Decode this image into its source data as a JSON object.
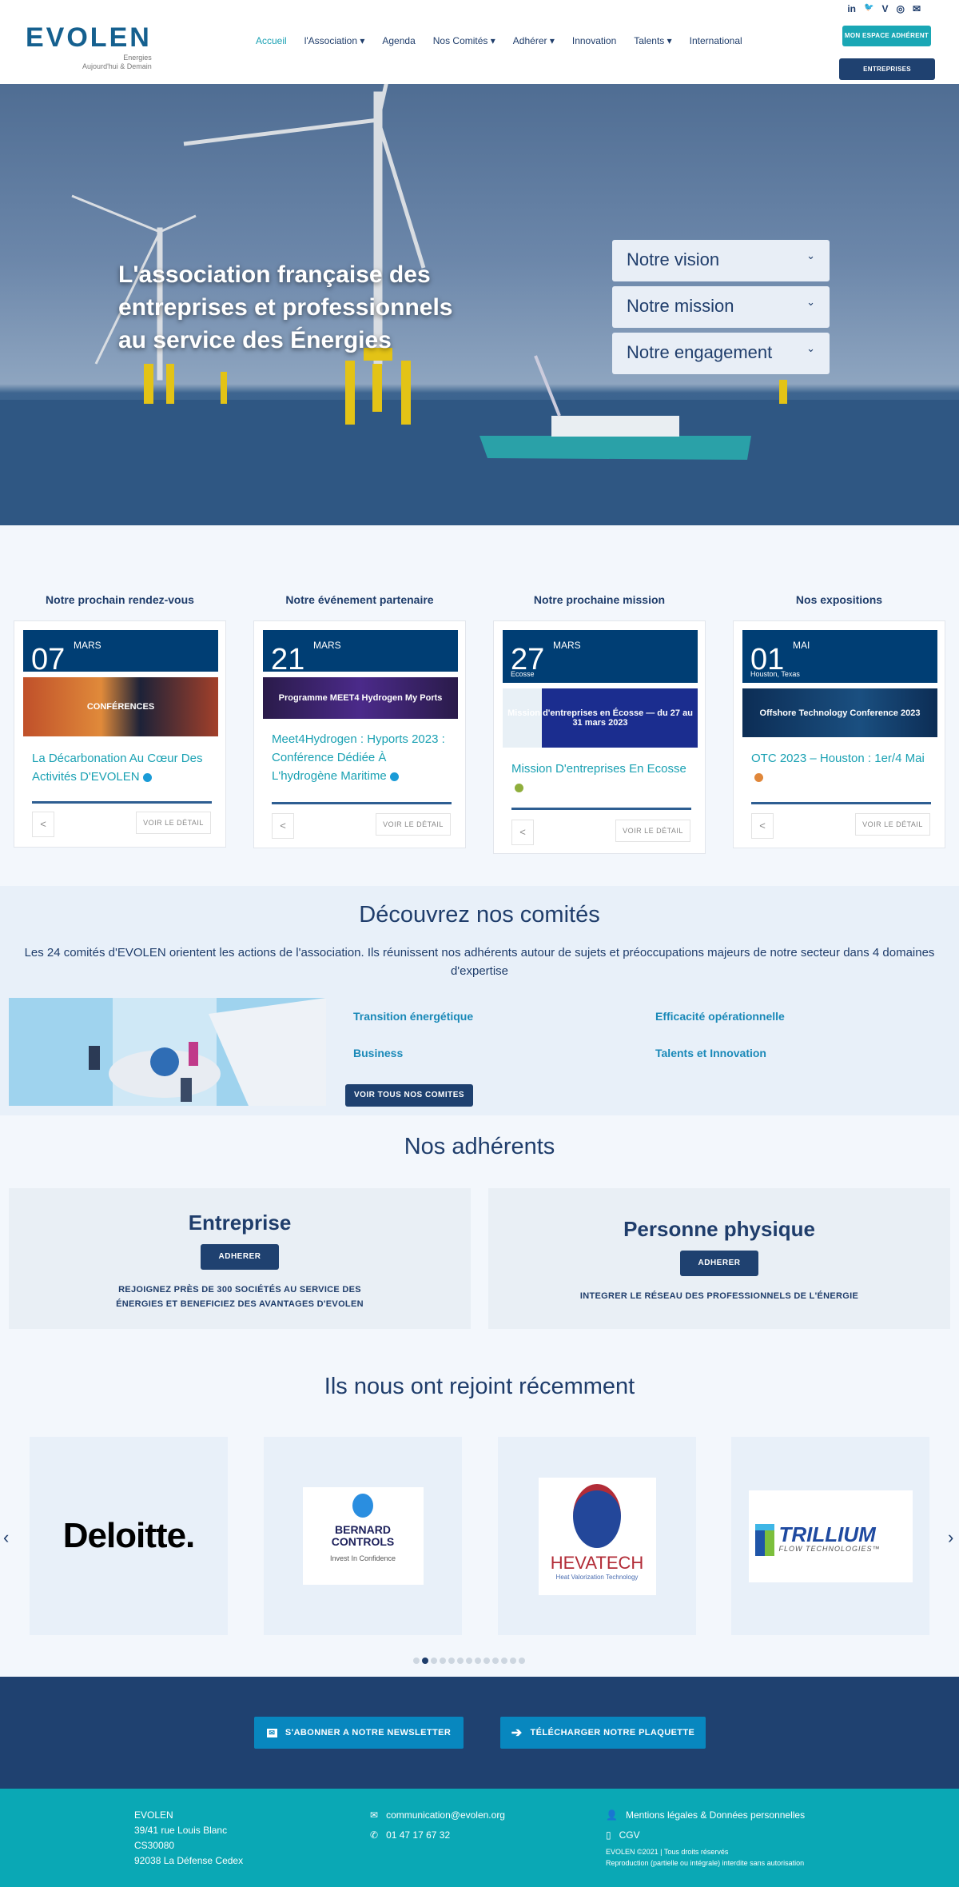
{
  "header": {
    "logo_text": "EVOLEN",
    "logo_tagline_1": "Energies",
    "logo_tagline_2": "Aujourd'hui & Demain",
    "nav": [
      {
        "label": "Accueil",
        "active": true
      },
      {
        "label": "l'Association ▾"
      },
      {
        "label": "Agenda"
      },
      {
        "label": "Nos Comités ▾"
      },
      {
        "label": "Adhérer ▾"
      },
      {
        "label": "Innovation"
      },
      {
        "label": "Talents ▾"
      },
      {
        "label": "International"
      }
    ],
    "social": [
      "in",
      "🐦",
      "V",
      "◎",
      "✉"
    ],
    "member_space_label": "MON ESPACE ADHÉRENT",
    "member_companies_label": "ENTREPRISES ADHÉRENTES"
  },
  "hero": {
    "title": "L'association française des entreprises et professionnels au service des Énergies",
    "accordion": [
      "Notre vision",
      "Notre mission",
      "Notre engagement"
    ]
  },
  "events": [
    {
      "heading": "Notre prochain rendez-vous",
      "day": "07",
      "month": "MARS",
      "location": "",
      "image_text": "CONFÉRENCES",
      "title": "La Décarbonation Au Cœur Des Activités D'EVOLEN",
      "dot_color": "#1a9bd7",
      "detail": "VOIR LE DÉTAIL"
    },
    {
      "heading": "Notre événement partenaire",
      "day": "21",
      "month": "MARS",
      "location": "",
      "image_text": "Programme MEET4 Hydrogen My Ports",
      "title": "Meet4Hydrogen : Hyports 2023 : Conférence Dédiée À L'hydrogène Maritime",
      "dot_color": "#1a9bd7",
      "detail": "VOIR LE DÉTAIL"
    },
    {
      "heading": "Notre prochaine mission",
      "day": "27",
      "month": "MARS",
      "location": "Ecosse",
      "image_text": "Mission d'entreprises en Écosse — du 27 au 31 mars 2023",
      "title": "Mission D'entreprises En Ecosse",
      "dot_color": "#8fae3c",
      "detail": "VOIR LE DÉTAIL"
    },
    {
      "heading": "Nos expositions",
      "day": "01",
      "month": "MAI",
      "location": "Houston, Texas",
      "image_text": "Offshore Technology Conference 2023",
      "title": "OTC 2023 – Houston : 1er/4 Mai",
      "dot_color": "#e0873a",
      "detail": "VOIR LE DÉTAIL"
    }
  ],
  "comites": {
    "title": "Découvrez nos comités",
    "description": "Les 24 comités d'EVOLEN orientent les actions de l'association. Ils réunissent nos adhérents autour de sujets et préoccupations majeurs de notre secteur dans 4 domaines d'expertise",
    "links": [
      "Transition énergétique",
      "Efficacité opérationnelle",
      "Business",
      "Talents et Innovation"
    ],
    "button": "VOIR TOUS NOS COMITES"
  },
  "adherents": {
    "title": "Nos adhérents",
    "cards": [
      {
        "title": "Entreprise",
        "button": "ADHERER",
        "text": "REJOIGNEZ PRÈS DE 300 SOCIÉTÉS AU SERVICE DES ÉNERGIES ET BENEFICIEZ DES AVANTAGES D'EVOLEN"
      },
      {
        "title": "Personne physique",
        "button": "ADHERER",
        "text": "INTEGRER LE RÉSEAU DES PROFESSIONNELS DE L'ÉNERGIE"
      }
    ]
  },
  "recent": {
    "title": "Ils nous ont rejoint récemment",
    "logos": [
      "Deloitte.",
      "BERNARD CONTROLS",
      "HEVATECH",
      "TRILLIUM"
    ],
    "logo_subtitles": [
      "",
      "Invest In Confidence",
      "Heat Valorization Technology",
      "FLOW TECHNOLOGIES™"
    ],
    "dots_total": 13,
    "dots_active": 2
  },
  "band": {
    "newsletter": "S'ABONNER A NOTRE NEWSLETTER",
    "brochure": "TÉLÉCHARGER NOTRE PLAQUETTE"
  },
  "footer": {
    "address": [
      "EVOLEN",
      "39/41 rue Louis Blanc",
      "CS30080",
      "92038 La Défense Cedex"
    ],
    "email": "communication@evolen.org",
    "phone": "01 47 17 67 32",
    "legal": "Mentions légales & Données personnelles",
    "cgv": "CGV",
    "copyright": "EVOLEN ©2021 | Tous droits réservés",
    "reproduction": "Reproduction (partielle ou intégrale) interdite sans autorisation"
  },
  "colors": {
    "navy": "#1f4170",
    "teal": "#0aa8b5",
    "link": "#1aa1b3",
    "date_bg": "#003e74"
  }
}
